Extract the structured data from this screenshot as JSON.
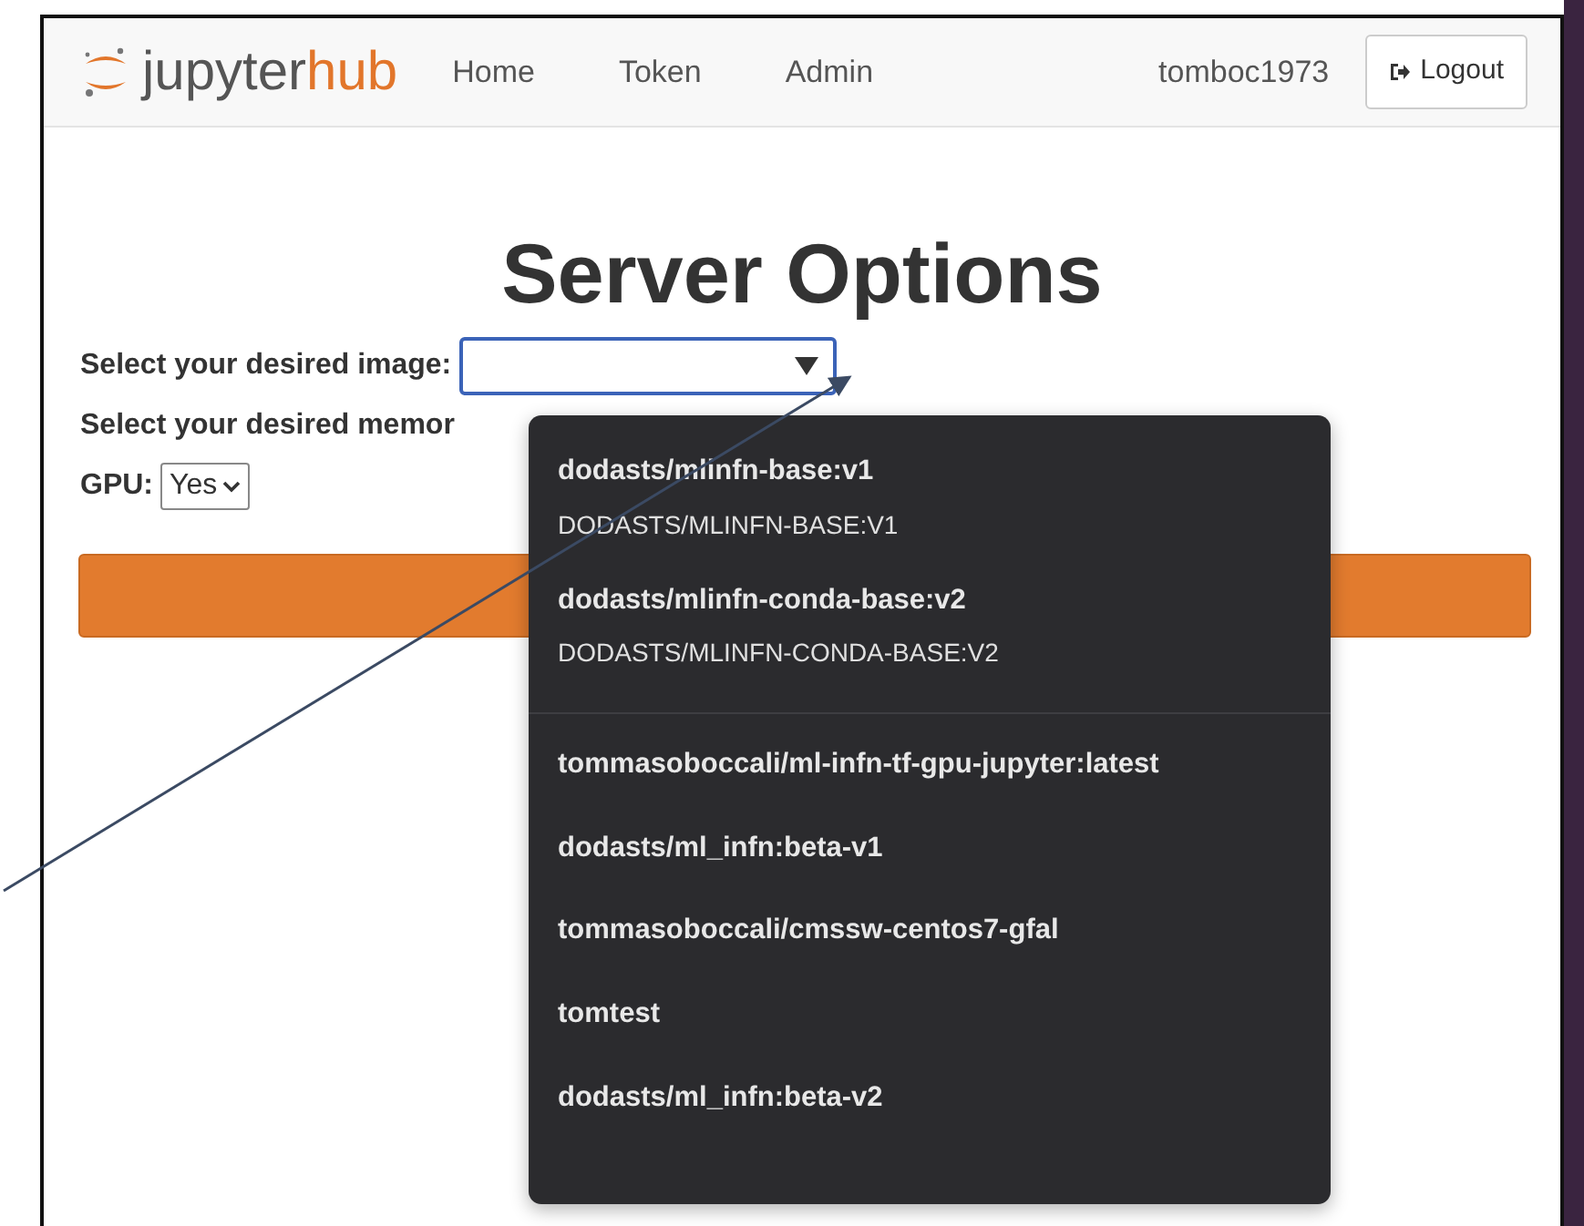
{
  "navbar": {
    "logo": {
      "part_1": "jupyter",
      "part_2": "hub"
    },
    "links": [
      "Home",
      "Token",
      "Admin"
    ],
    "user": "tomboc1973",
    "logout_button": {
      "label": "Logout"
    }
  },
  "heading": "Server Options",
  "fields": [
    {
      "kind": "select",
      "label": "Select your desired image:",
      "focused": true
    },
    {
      "kind": "label",
      "label": "Select your desired memor"
    },
    {
      "kind": "select",
      "label": "GPU:",
      "value": "Yes",
      "focused": false
    }
  ],
  "dropdown": {
    "groups": [
      {
        "options": [
          {
            "label": "dodasts/mlinfn-base:v1",
            "description": "DODASTS/MLINFN-BASE:V1"
          },
          {
            "label": "dodasts/mlinfn-conda-base:v2",
            "description": "DODASTS/MLINFN-CONDA-BASE:V2"
          }
        ]
      },
      {
        "options": [
          {
            "label": "tommasoboccali/ml-infn-tf-gpu-jupyter:latest"
          },
          {
            "label": "dodasts/ml_infn:beta-v1"
          },
          {
            "label": "tommasoboccali/cmssw-centos7-gfal"
          },
          {
            "label": "tomtest"
          },
          {
            "label": "dodasts/ml_infn:beta-v2"
          }
        ]
      }
    ]
  }
}
